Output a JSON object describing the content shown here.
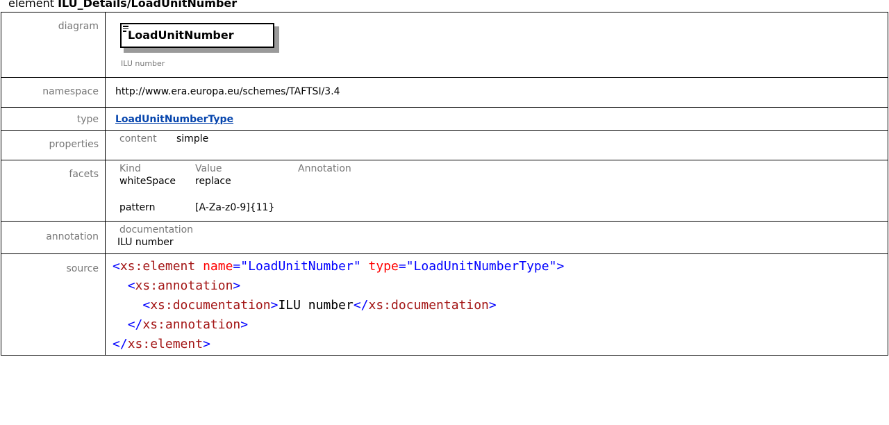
{
  "heading": {
    "prefix": "element ",
    "name": "ILU_Details/LoadUnitNumber"
  },
  "rows": {
    "diagram": {
      "label": "diagram",
      "box_text": "LoadUnitNumber",
      "doc_text": "ILU number"
    },
    "namespace": {
      "label": "namespace",
      "value": "http://www.era.europa.eu/schemes/TAFTSI/3.4"
    },
    "type": {
      "label": "type",
      "value": "LoadUnitNumberType"
    },
    "properties": {
      "label": "properties",
      "key": "content",
      "value": "simple"
    },
    "facets": {
      "label": "facets",
      "headers": [
        "Kind",
        "Value",
        "Annotation"
      ],
      "items": [
        {
          "kind": "whiteSpace",
          "value": "replace"
        },
        {
          "kind": "pattern",
          "value": "[A-Za-z0-9]{11}"
        }
      ]
    },
    "annotation": {
      "label": "annotation",
      "key": "documentation",
      "value": "ILU number"
    },
    "source": {
      "label": "source",
      "el_open_tag": "xs:element",
      "attr_name": "name",
      "attr_name_val": "\"LoadUnitNumber\"",
      "attr_type": "type",
      "attr_type_val": "\"LoadUnitNumberType\"",
      "annotation_tag": "xs:annotation",
      "documentation_tag": "xs:documentation",
      "doc_text": "ILU number",
      "el_close_tag": "xs:element"
    }
  },
  "colors": {
    "tag": "#a31515",
    "bracket": "#0000ff",
    "attr": "#ff0000",
    "link": "#0645ad",
    "label": "#777777"
  }
}
